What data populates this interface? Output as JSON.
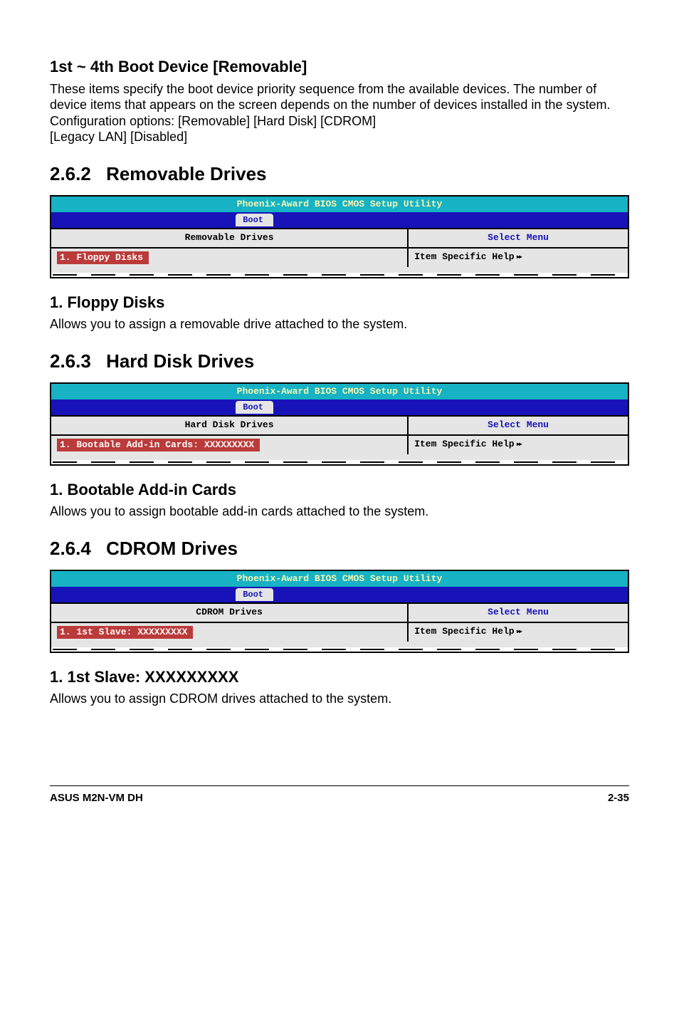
{
  "s1": {
    "heading": "1st ~ 4th Boot Device [Removable]",
    "p1": "These items specify the boot device priority sequence from the available devices. The number of device items that appears on the screen depends on the number of devices installed in the system.",
    "p2": "Configuration options: [Removable] [Hard Disk] [CDROM]",
    "p3": "[Legacy LAN] [Disabled]"
  },
  "s2": {
    "num": "2.6.2",
    "title": "Removable Drives",
    "bios": {
      "title": "Phoenix-Award BIOS CMOS Setup Utility",
      "tab": "Boot",
      "header_left": "Removable Drives",
      "header_right": "Select Menu",
      "body_left": "1. Floppy Disks",
      "body_right": "Item Specific Help"
    },
    "sub_heading": "1. Floppy Disks",
    "sub_text": "Allows you to assign a removable drive attached to the system."
  },
  "s3": {
    "num": "2.6.3",
    "title": "Hard Disk Drives",
    "bios": {
      "title": "Phoenix-Award BIOS CMOS Setup Utility",
      "tab": "Boot",
      "header_left": "Hard Disk Drives",
      "header_right": "Select Menu",
      "body_left": "1. Bootable Add-in Cards: XXXXXXXXX",
      "body_right": "Item Specific Help"
    },
    "sub_heading": "1. Bootable Add-in Cards",
    "sub_text": "Allows you to assign bootable add-in cards attached to the system."
  },
  "s4": {
    "num": "2.6.4",
    "title": "CDROM Drives",
    "bios": {
      "title": "Phoenix-Award BIOS CMOS Setup Utility",
      "tab": "Boot",
      "header_left": "CDROM Drives",
      "header_right": "Select Menu",
      "body_left": "1. 1st Slave: XXXXXXXXX",
      "body_right": "Item Specific Help"
    },
    "sub_heading": "1. 1st Slave: XXXXXXXXX",
    "sub_text": "Allows you to assign CDROM drives attached to the system."
  },
  "footer": {
    "left": "ASUS M2N-VM DH",
    "right": "2-35"
  }
}
